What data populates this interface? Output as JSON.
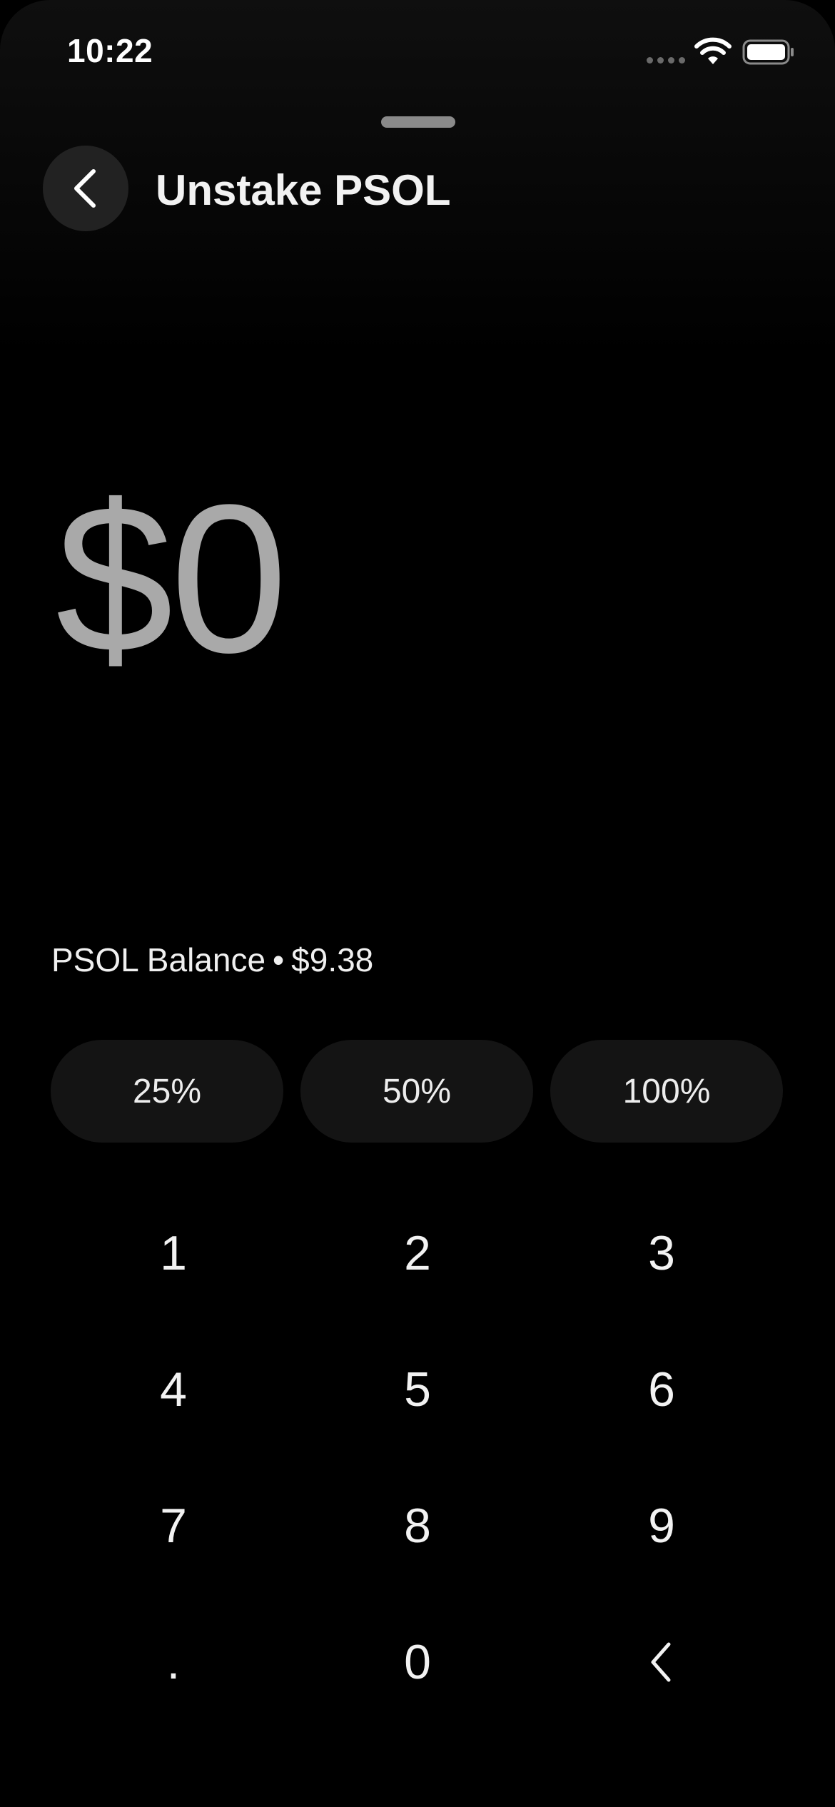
{
  "status_bar": {
    "time": "10:22"
  },
  "header": {
    "title": "Unstake PSOL",
    "back_icon": "chevron-left-icon"
  },
  "amount": {
    "display": "$0"
  },
  "balance": {
    "label": "PSOL Balance",
    "separator": "•",
    "value": "$9.38"
  },
  "percent_buttons": [
    "25%",
    "50%",
    "100%"
  ],
  "keypad": {
    "keys": [
      "1",
      "2",
      "3",
      "4",
      "5",
      "6",
      "7",
      "8",
      "9",
      ".",
      "0"
    ],
    "backspace_icon": "chevron-left-icon"
  },
  "colors": {
    "background": "#000000",
    "amount_text": "#a9a9a9",
    "button_bg": "#141414",
    "back_button_bg": "#222222"
  }
}
